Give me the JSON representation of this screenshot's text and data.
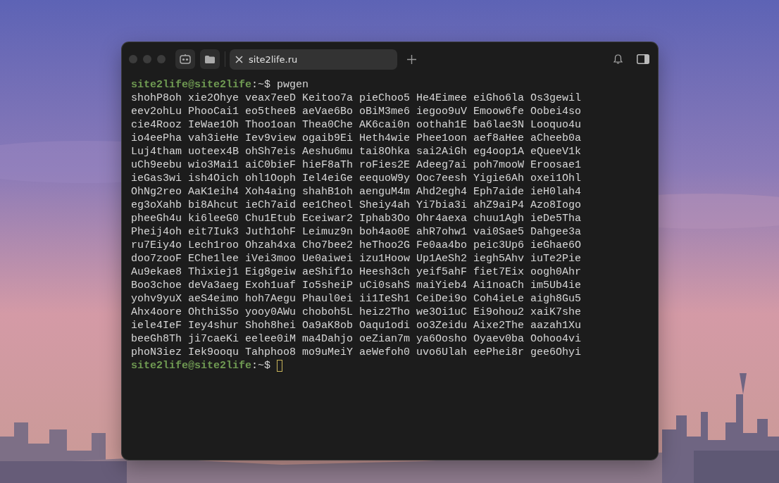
{
  "tab": {
    "title": "site2life.ru",
    "selected": true
  },
  "terminal": {
    "command_prompt": {
      "user_host": "site2life@site2life",
      "path": ":~$",
      "command": "pwgen"
    },
    "output": [
      "shohP8oh xie2Ohye veax7eeD Keitoo7a pieChoo5 He4Eimee eiGho6la Os3gewil",
      "eev2ohLu PhooCai1 eo5theeB aeVae6Bo oBiM3me6 iegoo9uV Emoow6fe Oobei4so",
      "cie4Rooz IeWae1Oh Thoo1oan Thea0Che AK6cai0n oothah1E ba6lae3N Looquo4u",
      "io4eePha vah3ieHe Iev9view ogaib9Ei Heth4wie Phee1oon aef8aHee aCheeb0a",
      "Luj4tham uoteex4B ohSh7eis Aeshu6mu tai8Ohka sai2AiGh eg4oop1A eQueeV1k",
      "uCh9eebu wio3Mai1 aiC0bieF hieF8aTh roFies2E Adeeg7ai poh7mooW Eroosae1",
      "ieGas3wi ish4Oich ohl1Ooph Iel4eiGe eequoW9y Ooc7eesh Yigie6Ah oxei1Ohl",
      "OhNg2reo AaK1eih4 Xoh4aing shahB1oh aenguM4m Ahd2egh4 Eph7aide ieH0lah4",
      "eg3oXahb bi8Ahcut ieCh7aid ee1Cheol Sheiy4ah Yi7bia3i ahZ9aiP4 Azo8Iogo",
      "pheeGh4u ki6leeG0 Chu1Etub Eceiwar2 Iphab3Oo Ohr4aexa chuu1Agh ieDe5Tha",
      "Pheij4oh eit7Iuk3 Juth1ohF Leimuz9n boh4ao0E ahR7ohw1 vai0Sae5 Dahgee3a",
      "ru7Eiy4o Lech1roo Ohzah4xa Cho7bee2 heThoo2G Fe0aa4bo peic3Up6 ieGhae6O",
      "doo7zooF EChe1lee iVei3moo Ue0aiwei izu1Hoow Up1AeSh2 iegh5Ahv iuTe2Pie",
      "Au9ekae8 Thixiej1 Eig8geiw aeShif1o Heesh3ch yeif5ahF fiet7Eix oogh0Ahr",
      "Boo3choe deVa3aeg Exoh1uaf Io5sheiP uCi0sahS maiYieb4 Ai1noaCh im5Ub4ie",
      "yohv9yuX aeS4eimo hoh7Aegu Phaul0ei ii1IeSh1 CeiDei9o Coh4ieLe aigh8Gu5",
      "Ahx4oore OhthiS5o yooy0AWu choboh5L heiz2Tho we3Oi1uC Ei9ohou2 xaiK7she",
      "iele4IeF Iey4shur Shoh8hei Oa9aK8ob Oaqu1odi oo3Zeidu Aixe2The aazah1Xu",
      "beeGh8Th ji7caeKi eelee0iM ma4Dahjo oeZian7m ya6Oosho Oyaev0ba Oohoo4vi",
      "phoN3iez Iek9ooqu Tahphoo8 mo9uMeiY aeWefoh0 uvo6Ulah eePhei8r gee6Ohyi"
    ],
    "final_prompt": {
      "user_host": "site2life@site2life",
      "path": ":~$"
    }
  }
}
